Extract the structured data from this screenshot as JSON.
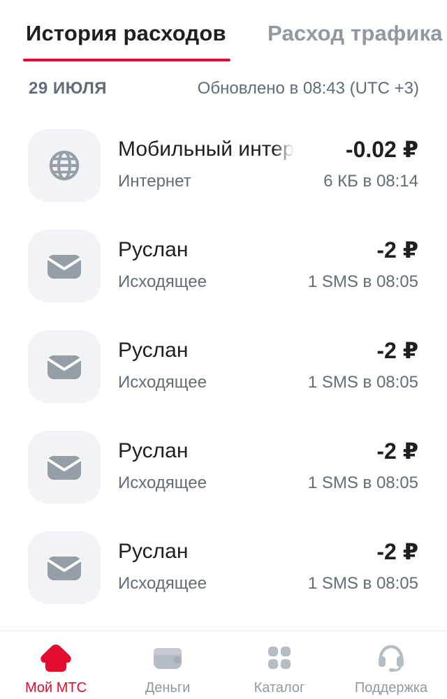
{
  "tabs": [
    {
      "label": "История расходов",
      "active": true
    },
    {
      "label": "Расход трафика",
      "active": false
    }
  ],
  "date_row": {
    "date": "29 ИЮЛЯ",
    "updated": "Обновлено в 08:43 (UTC +3)"
  },
  "items": [
    {
      "icon": "globe-icon",
      "title": "Мобильный интер",
      "subtitle": "Интернет",
      "amount": "-0.02 ₽",
      "detail": "6 КБ в 08:14"
    },
    {
      "icon": "envelope-icon",
      "title": "Руслан",
      "subtitle": "Исходящее",
      "amount": "-2 ₽",
      "detail": "1 SMS в 08:05"
    },
    {
      "icon": "envelope-icon",
      "title": "Руслан",
      "subtitle": "Исходящее",
      "amount": "-2 ₽",
      "detail": "1 SMS в 08:05"
    },
    {
      "icon": "envelope-icon",
      "title": "Руслан",
      "subtitle": "Исходящее",
      "amount": "-2 ₽",
      "detail": "1 SMS в 08:05"
    },
    {
      "icon": "envelope-icon",
      "title": "Руслан",
      "subtitle": "Исходящее",
      "amount": "-2 ₽",
      "detail": "1 SMS в 08:05"
    }
  ],
  "bottom_nav": [
    {
      "label": "Мой МТС",
      "icon": "home-icon",
      "active": true
    },
    {
      "label": "Деньги",
      "icon": "wallet-icon",
      "active": false
    },
    {
      "label": "Каталог",
      "icon": "grid-icon",
      "active": false
    },
    {
      "label": "Поддержка",
      "icon": "headset-icon",
      "active": false
    }
  ],
  "colors": {
    "accent": "#e30b2e",
    "text_primary": "#1d2023",
    "text_secondary": "#626c77",
    "text_inactive": "#9198a0",
    "icon_bg": "#f2f3f7",
    "icon_fill": "#969fa8"
  }
}
